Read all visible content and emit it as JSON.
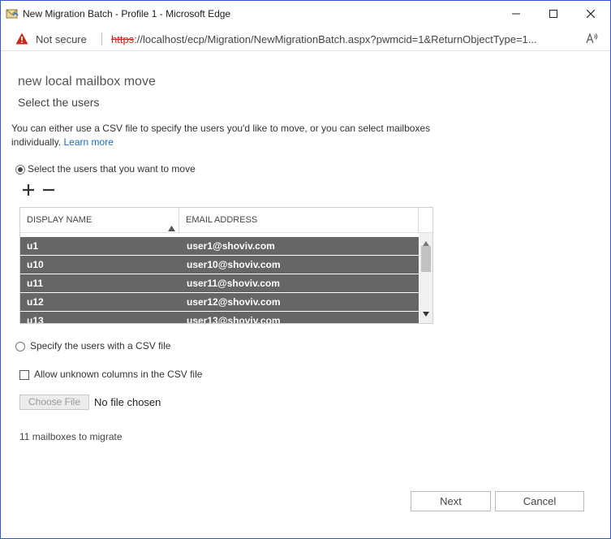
{
  "window": {
    "title": "New Migration Batch - Profile 1 - Microsoft Edge"
  },
  "address_bar": {
    "security_label": "Not secure",
    "url_protocol": "https",
    "url_rest": "://localhost/ecp/Migration/NewMigrationBatch.aspx?pwmcid=1&ReturnObjectType=1..."
  },
  "page": {
    "heading": "new local mailbox move",
    "subheading": "Select the users",
    "intro_text": "You can either use a CSV file to specify the users you'd like to move, or you can select mailboxes individually.",
    "learn_more": "Learn more",
    "option_select_users": "Select the users that you want to move",
    "option_csv": "Specify the users with a CSV file",
    "allow_unknown_columns": "Allow unknown columns in the CSV file",
    "choose_file": "Choose File",
    "no_file": "No file chosen",
    "mailbox_count": "11 mailboxes to migrate",
    "next": "Next",
    "cancel": "Cancel"
  },
  "table": {
    "col_display_name": "DISPLAY NAME",
    "col_email": "EMAIL ADDRESS",
    "rows": [
      {
        "name": "u1",
        "email": "user1@shoviv.com"
      },
      {
        "name": "u10",
        "email": "user10@shoviv.com"
      },
      {
        "name": "u11",
        "email": "user11@shoviv.com"
      },
      {
        "name": "u12",
        "email": "user12@shoviv.com"
      },
      {
        "name": "u13",
        "email": "user13@shoviv.com"
      }
    ]
  },
  "colors": {
    "selected_row": "#666666",
    "link": "#1b6ac9",
    "warning": "#c42b1c"
  },
  "icons": [
    "migration-app-icon",
    "warning-icon",
    "read-aloud-icon",
    "plus-icon",
    "minus-icon",
    "sort-up-icon"
  ]
}
